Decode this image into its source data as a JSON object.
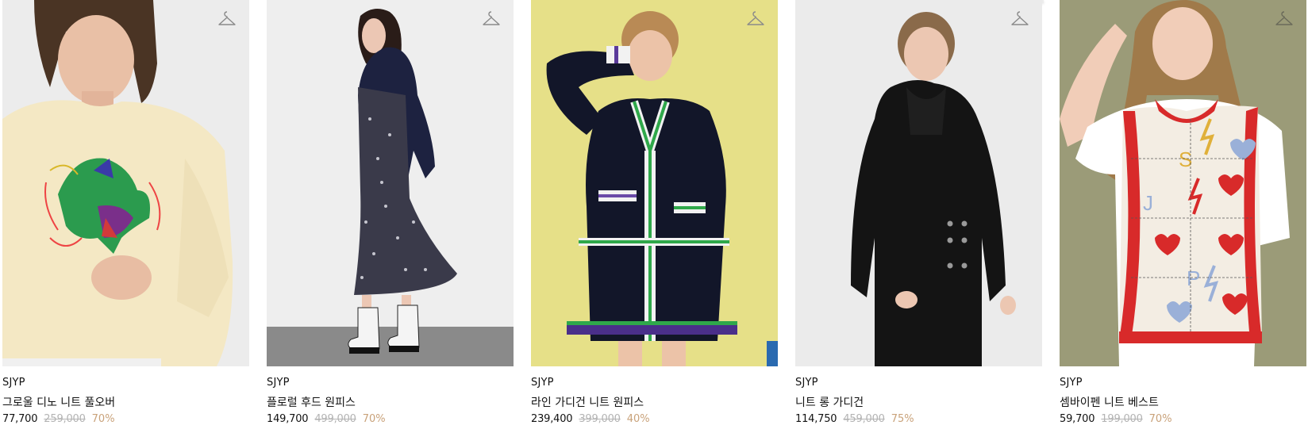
{
  "products": [
    {
      "brand": "SJYP",
      "name": "그로울 디노 니트 풀오버",
      "sale_price": "77,700",
      "original_price": "259,000",
      "discount": "70%",
      "image_desc": "dino-sweater"
    },
    {
      "brand": "SJYP",
      "name": "플로럴 후드 원피스",
      "sale_price": "149,700",
      "original_price": "499,000",
      "discount": "70%",
      "image_desc": "floral-hood-dress"
    },
    {
      "brand": "SJYP",
      "name": "라인 가디건 니트 원피스",
      "sale_price": "239,400",
      "original_price": "399,000",
      "discount": "40%",
      "image_desc": "line-cardigan-dress"
    },
    {
      "brand": "SJYP",
      "name": "니트 롱 가디건",
      "sale_price": "114,750",
      "original_price": "459,000",
      "discount": "75%",
      "image_desc": "long-cardigan"
    },
    {
      "brand": "SJYP",
      "name": "셈바이펜 니트 베스트",
      "sale_price": "59,700",
      "original_price": "199,000",
      "discount": "70%",
      "image_desc": "knit-vest"
    }
  ],
  "colors": {
    "discount": "#c9a27a",
    "original_price": "#b3b3b3",
    "hanger_icon": "#8a8a8a"
  }
}
